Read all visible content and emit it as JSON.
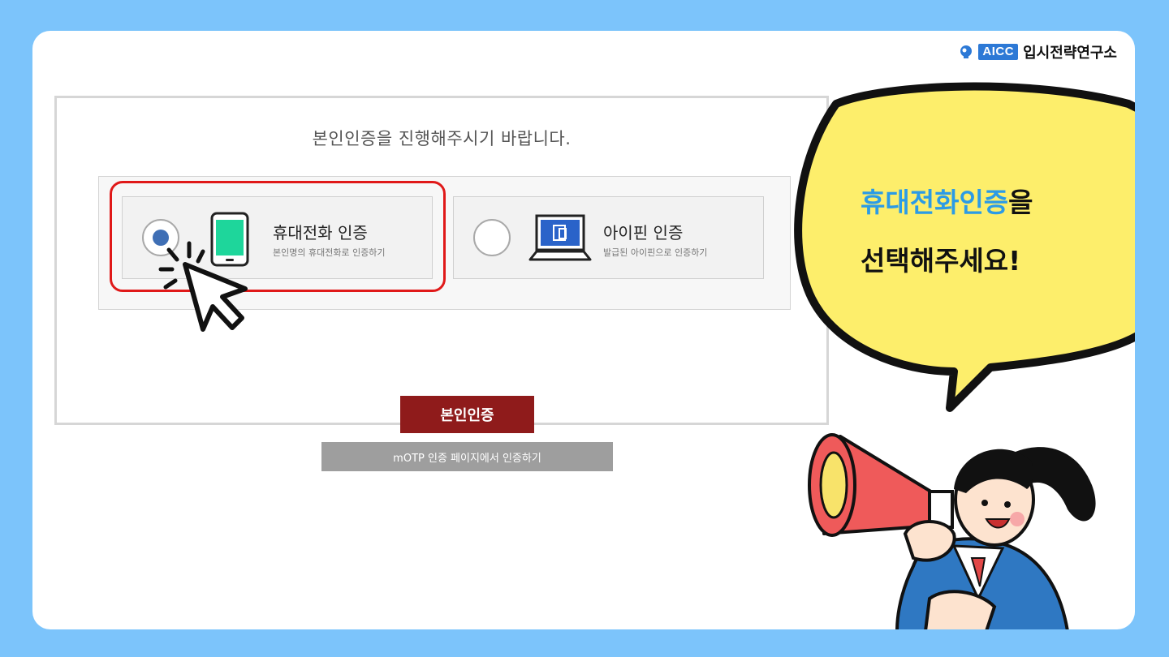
{
  "brand": {
    "badge": "AICC",
    "org_name": "입시전략연구소"
  },
  "auth_panel": {
    "title": "본인인증을 진행해주시기 바랍니다.",
    "options": [
      {
        "name": "휴대전화 인증",
        "desc": "본인명의 휴대전화로 인증하기",
        "selected": true,
        "icon": "smartphone-icon"
      },
      {
        "name": "아이핀 인증",
        "desc": "발급된 아이핀으로 인증하기",
        "selected": false,
        "icon": "laptop-icon"
      }
    ],
    "primary_button": "본인인증",
    "secondary_button": "mOTP 인증 페이지에서 인증하기"
  },
  "callout": {
    "line1_highlight": "휴대전화인증",
    "line1_rest": "을",
    "line2": "선택해주세요!"
  },
  "colors": {
    "background": "#7cc4fb",
    "highlight_border": "#e01919",
    "primary_button": "#8f1b1b",
    "secondary_button": "#9e9e9e",
    "radio_selected": "#3f6fb5",
    "callout_bubble": "#fdee6b",
    "callout_highlight": "#2b9be6"
  }
}
